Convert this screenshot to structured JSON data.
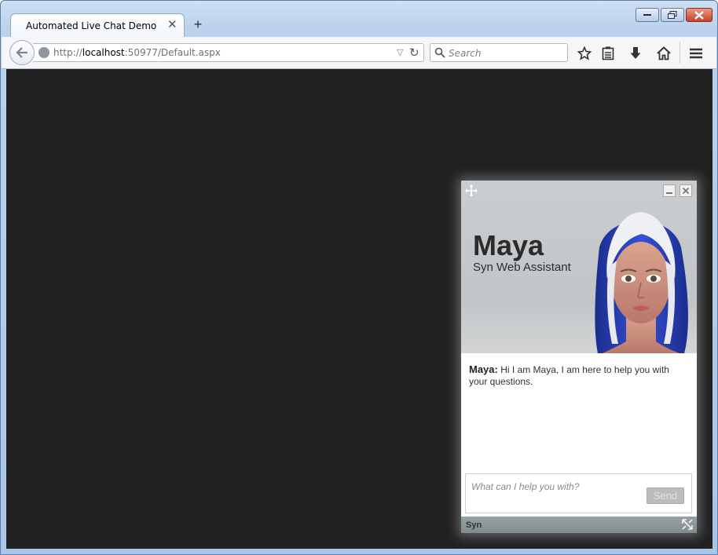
{
  "browser": {
    "tab_title": "Automated Live Chat Demo",
    "tab_close": "✕",
    "new_tab": "+",
    "url_scheme": "http://",
    "url_host": "localhost",
    "url_rest": ":50977/Default.aspx",
    "search_placeholder": "Search",
    "icons": [
      "back-icon",
      "globe-icon",
      "reload-icon",
      "search-icon",
      "star-icon",
      "reading-list-icon",
      "download-icon",
      "home-icon",
      "menu-icon"
    ]
  },
  "chat": {
    "agent_name": "Maya",
    "agent_role": "Syn Web Assistant",
    "messages": [
      {
        "author": "Maya:",
        "text": "Hi I am Maya, I am here to help you with your questions."
      }
    ],
    "input_placeholder": "What can I help you with?",
    "send_label": "Send",
    "footer_label": "Syn"
  },
  "colors": {
    "page_background": "#212121",
    "chat_footer": "#8a9396"
  }
}
